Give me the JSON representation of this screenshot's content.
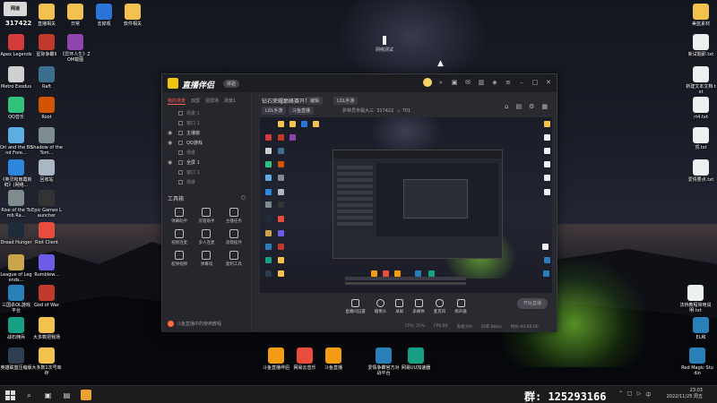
{
  "desktop": {
    "corner_logo": "网速",
    "corner_number": "317422",
    "icons": [
      {
        "id": "top-1",
        "label": "直播相关",
        "color": "#f2c14e"
      },
      {
        "id": "top-2",
        "label": "日常",
        "color": "#f2c14e"
      },
      {
        "id": "top-3",
        "label": "去掉观",
        "color": "#2a73d9"
      },
      {
        "id": "top-4",
        "label": "软件相关",
        "color": "#f2c14e"
      },
      {
        "id": "apex",
        "label": "Apex Legends",
        "color": "#d43b3b"
      },
      {
        "id": "star",
        "label": "星际争霸II",
        "color": "#c0392b"
      },
      {
        "id": "iqiyi",
        "label": "《异环人生》ZOM载图",
        "color": "#8e44ad"
      },
      {
        "id": "metro",
        "label": "Metro Exodus",
        "color": "#cfcfcf"
      },
      {
        "id": "raft",
        "label": "Raft",
        "color": "#3c6e8f"
      },
      {
        "id": "qq",
        "label": "QQ音乐",
        "color": "#31c27c"
      },
      {
        "id": "root",
        "label": "Root",
        "color": "#d35400"
      },
      {
        "id": "ori",
        "label": "Ori and the Blind Fore...",
        "color": "#5dade2"
      },
      {
        "id": "shadow",
        "label": "Shadow of the Tom...",
        "color": "#7f8c8d"
      },
      {
        "id": "hero",
        "label": "《英灵和雨霞新鲜》(网络...",
        "color": "#2e86de"
      },
      {
        "id": "recycle",
        "label": "回收站",
        "color": "#aab7c4"
      },
      {
        "id": "rise",
        "label": "Rise of the Tomb Ra...",
        "color": "#7f8c8d"
      },
      {
        "id": "epic",
        "label": "Epic Games Launcher",
        "color": "#333333"
      },
      {
        "id": "dread",
        "label": "Dread Hunger",
        "color": "#1f2a3a"
      },
      {
        "id": "riot",
        "label": "Riot Client",
        "color": "#e74c3c"
      },
      {
        "id": "lol",
        "label": "League of Legends...",
        "color": "#c9a64a"
      },
      {
        "id": "rumble",
        "label": "Rumblew...",
        "color": "#6c5ce7"
      },
      {
        "id": "sanguo",
        "label": "三国杀OL游戏平台",
        "color": "#2980b9"
      },
      {
        "id": "gow",
        "label": "God of War",
        "color": "#c0392b"
      },
      {
        "id": "zhanji",
        "label": "战石佣兵",
        "color": "#16a085"
      },
      {
        "id": "dadou",
        "label": "大多数把我场",
        "color": "#f2c14e"
      },
      {
        "id": "yinghe",
        "label": "英雄联盟压缩版",
        "color": "#2c3e50"
      },
      {
        "id": "dadou2",
        "label": "大多数1次号库存",
        "color": "#f2c14e"
      },
      {
        "id": "r-top",
        "label": "美蓝素材",
        "color": "#f2c14e"
      },
      {
        "id": "r-1",
        "label": "新试题即.txt",
        "color": "#ecf0f1"
      },
      {
        "id": "r-2",
        "label": "新建文本文档.txt",
        "color": "#ecf0f1"
      },
      {
        "id": "r-3",
        "label": "rt4.txt",
        "color": "#ecf0f1"
      },
      {
        "id": "r-4",
        "label": "顶.txt",
        "color": "#ecf0f1"
      },
      {
        "id": "r-5",
        "label": "爱情要点.txt",
        "color": "#ecf0f1"
      },
      {
        "id": "r-6",
        "label": "法桥教程常用说明.txt",
        "color": "#ecf0f1"
      },
      {
        "id": "r-7",
        "label": "EL和",
        "color": "#2980b9"
      },
      {
        "id": "redmagic",
        "label": "Red Magic Studio",
        "color": "#2980b9"
      },
      {
        "id": "b-1",
        "label": "斗鱼直播伴侣",
        "color": "#f39c12"
      },
      {
        "id": "b-2",
        "label": "网易云音乐",
        "color": "#e74c3c"
      },
      {
        "id": "b-3",
        "label": "斗鱼直播",
        "color": "#f39c12"
      },
      {
        "id": "b-4",
        "label": "爱情争霸官方对战平台",
        "color": "#2980b9"
      },
      {
        "id": "b-5",
        "label": "网易UU加速器",
        "color": "#16a085"
      }
    ],
    "center_mark": "网络测试"
  },
  "app": {
    "name": "直播伴侣",
    "version": "体验",
    "sidebar": {
      "tabs": [
        "我的场景",
        "双屏",
        "竖屏场",
        "场景1"
      ],
      "sources": [
        {
          "label": "场景 1",
          "on": false
        },
        {
          "label": "窗口 1",
          "on": false
        },
        {
          "label": "主播窗",
          "on": true
        },
        {
          "label": "QQ游戏",
          "on": true
        },
        {
          "label": "场景",
          "on": false
        },
        {
          "label": "全屏 1",
          "on": true
        },
        {
          "label": "窗口 1",
          "on": false
        },
        {
          "label": "场景",
          "on": false
        }
      ],
      "tools_title": "工具箱",
      "tools": [
        "弹幕助手",
        "房管助手",
        "主播任务",
        "视频连麦",
        "多人连麦",
        "滤镜插件",
        "超弹视频",
        "弹幕墙",
        "复制工具"
      ],
      "bottom_text": "斗鱼直播中的使用教程"
    },
    "content": {
      "room_title": "钻石荣耀巅峰赛开黑",
      "tag_edit": "编辑",
      "tag_game": "LOL手游",
      "tag_a": "LOL手游",
      "tag_b": "斗鱼直播",
      "room_owner": "护林员专属大三",
      "room_id": "317422",
      "heat": "701",
      "actions": [
        "直播间设置",
        "摄像头",
        "录屏",
        "多媒体",
        "麦克风",
        "扬声器"
      ],
      "start_label": "开始直播",
      "status": [
        "CPU: 25%",
        "FPS:60",
        "丢帧:0%",
        "码率:0kb/s",
        "时长:00:00:00"
      ]
    }
  },
  "taskbar": {
    "group_text": "群: 125293166",
    "time": "23:03",
    "date": "2022/11/25 周五"
  }
}
